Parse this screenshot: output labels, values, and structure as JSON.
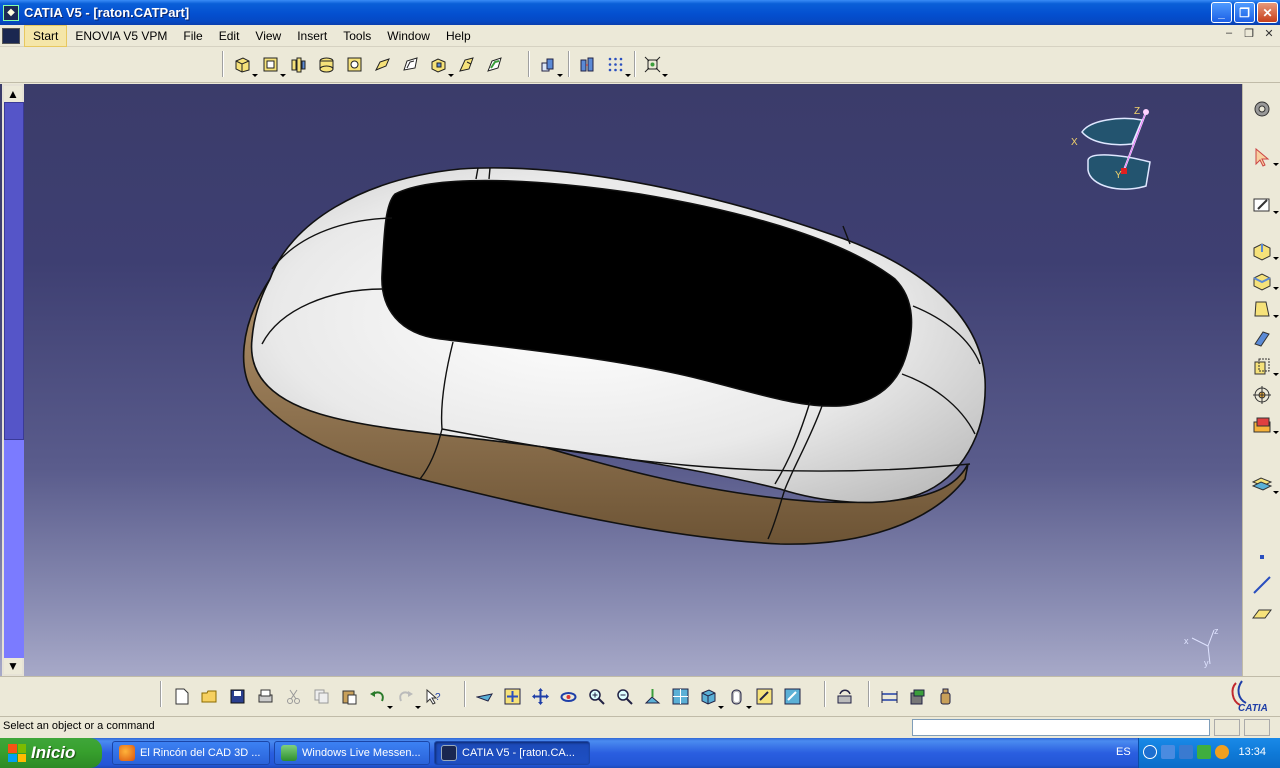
{
  "window": {
    "title": "CATIA V5 - [raton.CATPart]",
    "buttons": {
      "minimize": "_",
      "restore": "❐",
      "close": "✕"
    }
  },
  "menubar": {
    "items": [
      {
        "label": "Start"
      },
      {
        "label": "ENOVIA V5 VPM"
      },
      {
        "label": "File"
      },
      {
        "label": "Edit"
      },
      {
        "label": "View"
      },
      {
        "label": "Insert"
      },
      {
        "label": "Tools"
      },
      {
        "label": "Window"
      },
      {
        "label": "Help"
      }
    ],
    "mdi": {
      "minimize": "–",
      "restore": "❐",
      "close": "✕"
    }
  },
  "compass": {
    "x_label": "X",
    "y_label": "Y",
    "z_label": "Z"
  },
  "axis_triad": {
    "x": "x",
    "y": "y",
    "z": "z"
  },
  "brand": {
    "logo_text": "CATIA"
  },
  "statusbar": {
    "message": "Select an object or a command",
    "command_value": ""
  },
  "taskbar": {
    "start_label": "Inicio",
    "tasks": [
      {
        "label": "El Rincón del CAD 3D ..."
      },
      {
        "label": "Windows Live Messen..."
      },
      {
        "label": "CATIA V5 - [raton.CA..."
      }
    ],
    "language": "ES",
    "clock": "13:34"
  },
  "colors": {
    "viewport_top": "#3b3c6a",
    "viewport_bottom": "#a7a9c8",
    "model_shell": "#f2f2f2",
    "model_base": "#a98760",
    "model_top_pad": "#000000"
  }
}
